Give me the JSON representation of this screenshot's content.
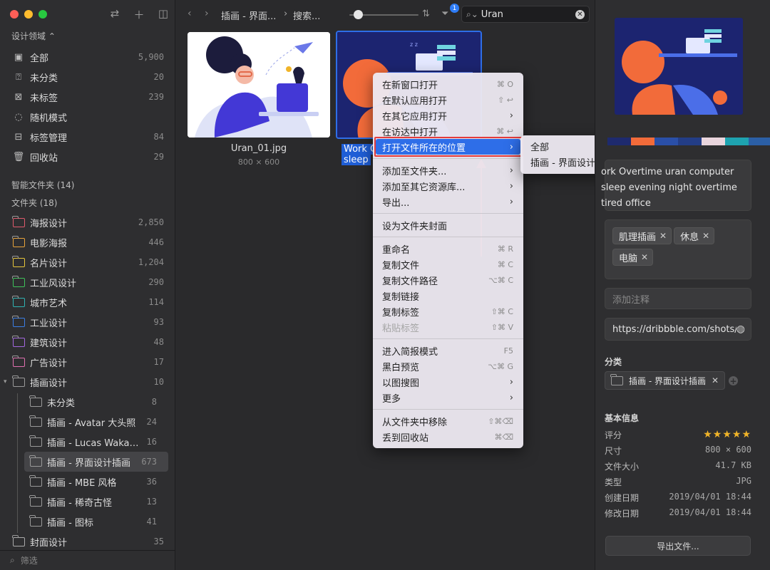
{
  "sidebar": {
    "domain_label": "设计领域",
    "library_items": [
      {
        "label": "全部",
        "count": "5,900",
        "icon": "inbox-icon"
      },
      {
        "label": "未分类",
        "count": "20",
        "icon": "unsorted-icon"
      },
      {
        "label": "未标签",
        "count": "239",
        "icon": "untagged-icon"
      },
      {
        "label": "随机模式",
        "count": "",
        "icon": "lightbulb-icon"
      },
      {
        "label": "标签管理",
        "count": "84",
        "icon": "tag-manager-icon"
      },
      {
        "label": "回收站",
        "count": "29",
        "icon": "trash-icon"
      }
    ],
    "smart_folders_header": "智能文件夹 (14)",
    "folders_header": "文件夹 (18)",
    "folders": [
      {
        "label": "海报设计",
        "count": "2,850",
        "color": "#e05a6b"
      },
      {
        "label": "电影海报",
        "count": "446",
        "color": "#e8a33a"
      },
      {
        "label": "名片设计",
        "count": "1,204",
        "color": "#e8c63a"
      },
      {
        "label": "工业风设计",
        "count": "290",
        "color": "#3ec25a"
      },
      {
        "label": "城市艺术",
        "count": "114",
        "color": "#2fb3b3"
      },
      {
        "label": "工业设计",
        "count": "93",
        "color": "#3b7ee6"
      },
      {
        "label": "建筑设计",
        "count": "48",
        "color": "#a368e0"
      },
      {
        "label": "广告设计",
        "count": "17",
        "color": "#e070b0"
      },
      {
        "label": "插画设计",
        "count": "10",
        "color": "#999999"
      }
    ],
    "subfolders": [
      {
        "label": "未分类",
        "count": "8"
      },
      {
        "label": "插画 - Avatar 大头照",
        "count": "24"
      },
      {
        "label": "插画 - Lucas Wakamatsu",
        "count": "16"
      },
      {
        "label": "插画 - 界面设计插画",
        "count": "673"
      },
      {
        "label": "插画 - MBE 风格",
        "count": "36"
      },
      {
        "label": "插画 - 稀奇古怪",
        "count": "13"
      },
      {
        "label": "插画 - 图标",
        "count": "41"
      }
    ],
    "cover_folder": {
      "label": "封面设计",
      "count": "35"
    },
    "filter_placeholder": "筛选"
  },
  "toolbar": {
    "crumb_1": "插画 - 界面...",
    "crumb_2": "搜索...",
    "search_value": "Uran",
    "filter_badge": "1"
  },
  "grid": {
    "items": [
      {
        "name": "Uran_01.jpg",
        "dims": "800 × 600"
      },
      {
        "name_line1": "Work O",
        "name_line2": "sleep"
      }
    ]
  },
  "context_menu": {
    "groups": [
      [
        {
          "label": "在新窗口打开",
          "shortcut": "⌘ O"
        },
        {
          "label": "在默认应用打开",
          "shortcut": "⇧ ↩"
        },
        {
          "label": "在其它应用打开",
          "submenu": true
        },
        {
          "label": "在访达中打开",
          "shortcut": "⌘ ↩"
        },
        {
          "label": "打开文件所在的位置",
          "submenu": true,
          "highlighted": true
        }
      ],
      [
        {
          "label": "添加至文件夹...",
          "submenu": true
        },
        {
          "label": "添加至其它资源库...",
          "submenu": true
        },
        {
          "label": "导出...",
          "submenu": true
        }
      ],
      [
        {
          "label": "设为文件夹封面"
        }
      ],
      [
        {
          "label": "重命名",
          "shortcut": "⌘ R"
        },
        {
          "label": "复制文件",
          "shortcut": "⌘ C"
        },
        {
          "label": "复制文件路径",
          "shortcut": "⌥⌘ C"
        },
        {
          "label": "复制链接"
        },
        {
          "label": "复制标签",
          "shortcut": "⇧⌘ C"
        },
        {
          "label": "粘贴标签",
          "shortcut": "⇧⌘ V",
          "disabled": true
        }
      ],
      [
        {
          "label": "进入简报模式",
          "shortcut": "F5"
        },
        {
          "label": "黑白预览",
          "shortcut": "⌥⌘ G"
        },
        {
          "label": "以图搜图",
          "submenu": true
        },
        {
          "label": "更多",
          "submenu": true
        }
      ],
      [
        {
          "label": "从文件夹中移除",
          "shortcut": "⇧⌘⌫"
        },
        {
          "label": "丢到回收站",
          "shortcut": "⌘⌫"
        }
      ]
    ],
    "submenu": [
      {
        "label": "全部"
      },
      {
        "label": "插画 - 界面设计插画"
      }
    ]
  },
  "inspector": {
    "palette": [
      "#1e2a6e",
      "#f26b3a",
      "#2a4fa8",
      "#233d86",
      "#e9d5dd",
      "#1ea3b0",
      "#2b5fa6"
    ],
    "title_text": "ork Overtime uran computer sleep evening night overtime tired office",
    "tags": [
      "肌理插画",
      "休息",
      "电脑"
    ],
    "note_placeholder": "添加注释",
    "url": "https://dribbble.com/shots/",
    "category_label": "分类",
    "category_folder": "插画 - 界面设计插画",
    "info_label": "基本信息",
    "info": [
      {
        "key": "评分",
        "value": "★★★★★",
        "rating": 5
      },
      {
        "key": "尺寸",
        "value": "800 × 600"
      },
      {
        "key": "文件大小",
        "value": "41.7 KB"
      },
      {
        "key": "类型",
        "value": "JPG"
      },
      {
        "key": "创建日期",
        "value": "2019/04/01 18:44"
      },
      {
        "key": "修改日期",
        "value": "2019/04/01 18:44"
      }
    ],
    "export_label": "导出文件..."
  }
}
